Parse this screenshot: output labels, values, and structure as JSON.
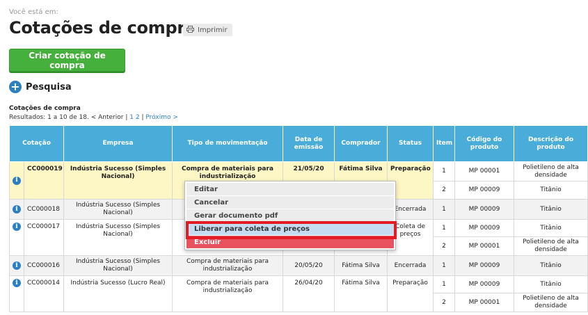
{
  "breadcrumb": "Você está em:",
  "title": "Cotações de compra",
  "print_label": "Imprimir",
  "create_button": "Criar cotação de compra",
  "search_label": "Pesquisa",
  "table_caption": "Cotações de compra",
  "results": {
    "prefix": "Resultados: 1 a 10 de 18.",
    "prev": "< Anterior",
    "sep": "|",
    "page1": "1",
    "page2": "2",
    "sep2": "|",
    "next": "Próximo >"
  },
  "headers": [
    "Cotação",
    "Empresa",
    "Tipo de movimentação",
    "Data de emissão",
    "Comprador",
    "Status",
    "Item",
    "Código do produto",
    "Descrição do produto"
  ],
  "rows": [
    {
      "cotacao": "CC000019",
      "empresa": "Indústria Sucesso (Simples Nacional)",
      "tipo": "Compra de materiais para industrialização",
      "data": "21/05/20",
      "comprador": "Fátima Silva",
      "status": "Preparação",
      "items": [
        {
          "item": "1",
          "codigo": "MP 00001",
          "descricao": "Polietileno de alta densidade"
        },
        {
          "item": "2",
          "codigo": "MP 00009",
          "descricao": "Titânio"
        }
      ]
    },
    {
      "cotacao": "CC000018",
      "empresa": "Indústria Sucesso (Simples Nacional)",
      "tipo": "",
      "data": "",
      "comprador": "",
      "status": "Encerrada",
      "items": [
        {
          "item": "1",
          "codigo": "MP 00009",
          "descricao": "Titânio"
        }
      ]
    },
    {
      "cotacao": "CC000017",
      "empresa": "Indústria Sucesso (Simples Nacional)",
      "tipo": "",
      "data": "",
      "comprador": "",
      "status": "Coleta de preços",
      "items": [
        {
          "item": "1",
          "codigo": "MP 00009",
          "descricao": "Titânio"
        },
        {
          "item": "2",
          "codigo": "MP 00001",
          "descricao": "Polietileno de alta densidade"
        }
      ]
    },
    {
      "cotacao": "CC000016",
      "empresa": "Indústria Sucesso (Simples Nacional)",
      "tipo": "Compra de materiais para industrialização",
      "data": "20/05/20",
      "comprador": "Fátima Silva",
      "status": "Encerrada",
      "items": [
        {
          "item": "1",
          "codigo": "MP 00009",
          "descricao": "Titânio"
        }
      ]
    },
    {
      "cotacao": "CC000014",
      "empresa": "Indústria Sucesso (Lucro Real)",
      "tipo": "Compra de materiais para industrialização",
      "data": "26/04/20",
      "comprador": "Fátima Silva",
      "status": "Preparação",
      "items": [
        {
          "item": "1",
          "codigo": "MP 00009",
          "descricao": "Titânio"
        },
        {
          "item": "2",
          "codigo": "MP 00001",
          "descricao": "Polietileno de alta densidade"
        }
      ]
    }
  ],
  "menu": [
    "Editar",
    "Cancelar",
    "Gerar documento pdf",
    "Liberar para coleta de preços",
    "Excluir"
  ],
  "colors": {
    "accent": "#4aacd9",
    "primary_button": "#45b03c",
    "highlight_row": "#fdf6c5",
    "danger": "#e8535f",
    "annotation": "#e31b23"
  }
}
